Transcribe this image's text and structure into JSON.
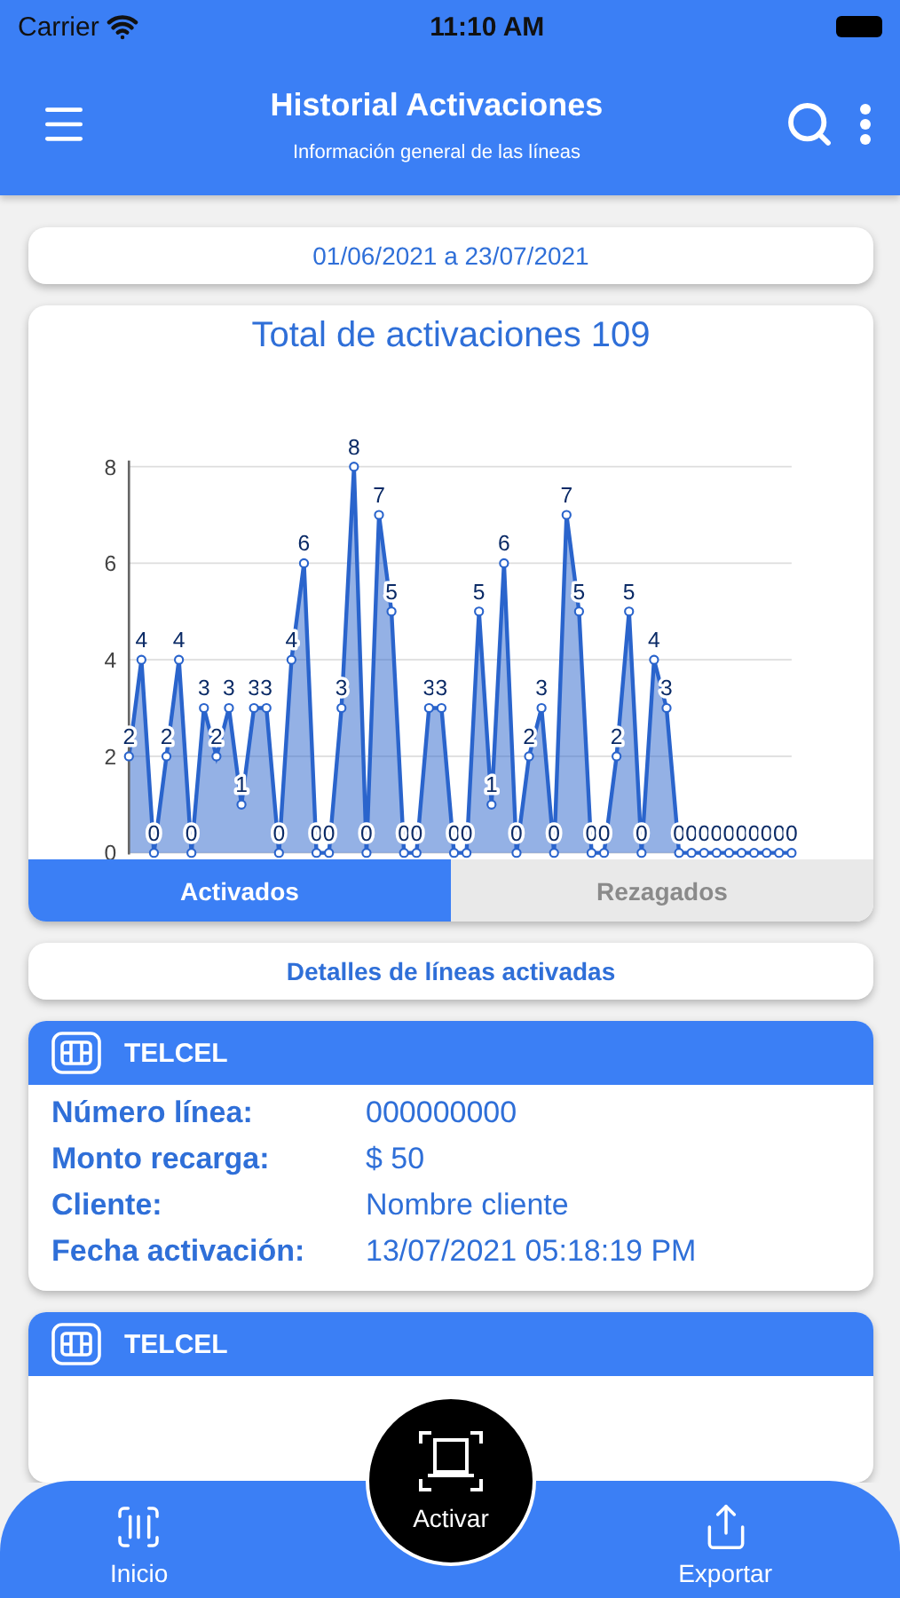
{
  "status_bar": {
    "carrier": "Carrier",
    "time": "11:10 AM"
  },
  "header": {
    "title": "Historial Activaciones",
    "subtitle": "Información general de las líneas"
  },
  "date_range": "01/06/2021 a 23/07/2021",
  "chart": {
    "chart_data": {
      "type": "area",
      "title": "Total de activaciones 109",
      "grid": true,
      "ylim": [
        0,
        8
      ],
      "yticks": [
        0,
        2,
        4,
        6,
        8
      ],
      "data_labels": true,
      "series": [
        {
          "color": "#2a64cc",
          "values": [
            2,
            4,
            0,
            2,
            4,
            0,
            3,
            2,
            3,
            1,
            3,
            3,
            0,
            4,
            6,
            0,
            0,
            3,
            8,
            0,
            7,
            5,
            0,
            0,
            3,
            3,
            0,
            0,
            5,
            1,
            6,
            0,
            2,
            3,
            0,
            7,
            5,
            0,
            0,
            2,
            5,
            0,
            4,
            3,
            0,
            0,
            0,
            0,
            0,
            0,
            0,
            0,
            0,
            0
          ]
        }
      ]
    }
  },
  "tabs": [
    {
      "label": "Activados",
      "selected": true
    },
    {
      "label": "Rezagados",
      "selected": false
    }
  ],
  "details_button": "Detalles de líneas activadas",
  "cards": [
    {
      "carrier": "TELCEL",
      "fields": [
        {
          "label": "Número línea:",
          "value": "000000000"
        },
        {
          "label": "Monto recarga:",
          "value": "$ 50"
        },
        {
          "label": "Cliente:",
          "value": "Nombre cliente"
        },
        {
          "label": "Fecha activación:",
          "value": "13/07/2021 05:18:19 PM"
        }
      ]
    },
    {
      "carrier": "TELCEL"
    }
  ],
  "bottom_nav": {
    "items": [
      {
        "label": "Inicio",
        "kind": "home"
      },
      {
        "label": "Exportar",
        "kind": "export"
      }
    ],
    "fab": "Activar"
  }
}
